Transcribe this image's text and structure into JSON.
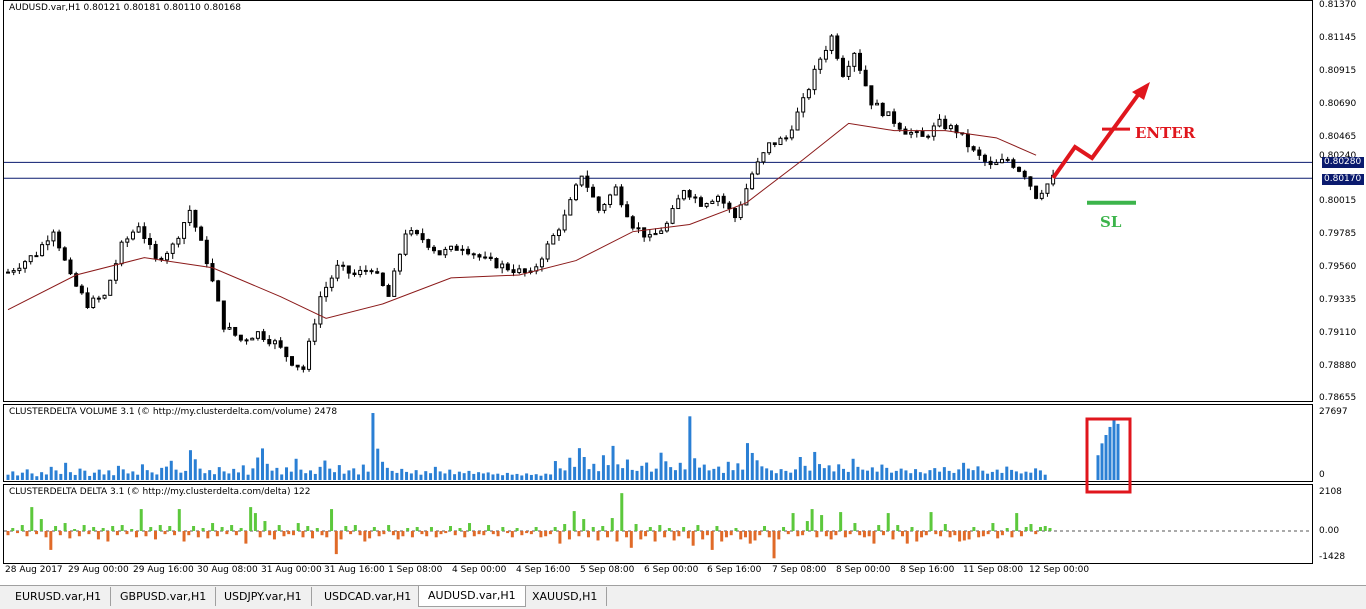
{
  "main_title": "AUDUSD.var,H1  0.80121 0.80181 0.80110 0.80168",
  "volume_title": "CLUSTERDELTA VOLUME 3.1 (© http://my.clusterdelta.com/volume) 2478",
  "delta_title": "CLUSTERDELTA DELTA 3.1 (© http://my.clusterdelta.com/delta) 122",
  "price_axis": [
    "0.81370",
    "0.81145",
    "0.80915",
    "0.80690",
    "0.80465",
    "0.80240",
    "0.80015",
    "0.79785",
    "0.79560",
    "0.79335",
    "0.79110",
    "0.78880",
    "0.78655"
  ],
  "price_tags": [
    "0.80280",
    "0.80170"
  ],
  "volume_axis": [
    "27697",
    "0"
  ],
  "delta_axis": [
    "2108",
    "0.00",
    "-1428"
  ],
  "time_axis": [
    "28 Aug 2017",
    "29 Aug 00:00",
    "29 Aug 16:00",
    "30 Aug 08:00",
    "31 Aug 00:00",
    "31 Aug 16:00",
    "1 Sep 08:00",
    "4 Sep 00:00",
    "4 Sep 16:00",
    "5 Sep 08:00",
    "6 Sep 00:00",
    "6 Sep 16:00",
    "7 Sep 08:00",
    "8 Sep 00:00",
    "8 Sep 16:00",
    "11 Sep 08:00",
    "12 Sep 00:00"
  ],
  "annotations": {
    "enter": "ENTER",
    "sl": "SL"
  },
  "tabs": [
    "EURUSD.var,H1",
    "GBPUSD.var,H1",
    "USDJPY.var,H1",
    "USDCAD.var,H1",
    "AUDUSD.var,H1",
    "XAUUSD,H1"
  ],
  "active_tab": 4,
  "colors": {
    "candle": "#000000",
    "ma": "#8b1a1a",
    "hline": "#0a1a6e",
    "vol": "#2a7fd4",
    "delta_pos": "#5cc83c",
    "delta_neg": "#e06a28",
    "arrow": "#e0161d",
    "sl": "#3cb44b",
    "box": "#e0161d"
  },
  "chart_data": [
    {
      "type": "candlestick",
      "title": "AUDUSD.var,H1  0.80121 0.80181 0.80110 0.80168",
      "ylim": [
        0.78655,
        0.8137
      ],
      "horizontal_lines": [
        0.8028,
        0.8017
      ],
      "close_path": [
        {
          "t": 0,
          "v": 0.7952
        },
        {
          "t": 5,
          "v": 0.7965
        },
        {
          "t": 8,
          "v": 0.7982
        },
        {
          "t": 11,
          "v": 0.7948
        },
        {
          "t": 14,
          "v": 0.793
        },
        {
          "t": 17,
          "v": 0.7935
        },
        {
          "t": 20,
          "v": 0.797
        },
        {
          "t": 23,
          "v": 0.7985
        },
        {
          "t": 26,
          "v": 0.796
        },
        {
          "t": 29,
          "v": 0.797
        },
        {
          "t": 32,
          "v": 0.7995
        },
        {
          "t": 35,
          "v": 0.796
        },
        {
          "t": 38,
          "v": 0.7915
        },
        {
          "t": 41,
          "v": 0.7905
        },
        {
          "t": 44,
          "v": 0.791
        },
        {
          "t": 47,
          "v": 0.7903
        },
        {
          "t": 50,
          "v": 0.789
        },
        {
          "t": 52,
          "v": 0.7885
        },
        {
          "t": 55,
          "v": 0.7935
        },
        {
          "t": 58,
          "v": 0.7955
        },
        {
          "t": 61,
          "v": 0.795
        },
        {
          "t": 64,
          "v": 0.7955
        },
        {
          "t": 67,
          "v": 0.7935
        },
        {
          "t": 70,
          "v": 0.798
        },
        {
          "t": 73,
          "v": 0.7975
        },
        {
          "t": 76,
          "v": 0.7965
        },
        {
          "t": 80,
          "v": 0.797
        },
        {
          "t": 84,
          "v": 0.796
        },
        {
          "t": 88,
          "v": 0.7955
        },
        {
          "t": 92,
          "v": 0.795
        },
        {
          "t": 95,
          "v": 0.797
        },
        {
          "t": 98,
          "v": 0.799
        },
        {
          "t": 101,
          "v": 0.802
        },
        {
          "t": 104,
          "v": 0.7995
        },
        {
          "t": 107,
          "v": 0.801
        },
        {
          "t": 110,
          "v": 0.7985
        },
        {
          "t": 113,
          "v": 0.7975
        },
        {
          "t": 116,
          "v": 0.7985
        },
        {
          "t": 119,
          "v": 0.801
        },
        {
          "t": 122,
          "v": 0.8
        },
        {
          "t": 125,
          "v": 0.8005
        },
        {
          "t": 128,
          "v": 0.799
        },
        {
          "t": 131,
          "v": 0.802
        },
        {
          "t": 134,
          "v": 0.804
        },
        {
          "t": 137,
          "v": 0.8045
        },
        {
          "t": 140,
          "v": 0.807
        },
        {
          "t": 143,
          "v": 0.81
        },
        {
          "t": 145,
          "v": 0.8115
        },
        {
          "t": 147,
          "v": 0.809
        },
        {
          "t": 149,
          "v": 0.8105
        },
        {
          "t": 152,
          "v": 0.807
        },
        {
          "t": 155,
          "v": 0.806
        },
        {
          "t": 158,
          "v": 0.805
        },
        {
          "t": 161,
          "v": 0.8045
        },
        {
          "t": 164,
          "v": 0.8055
        },
        {
          "t": 167,
          "v": 0.805
        },
        {
          "t": 170,
          "v": 0.8035
        },
        {
          "t": 173,
          "v": 0.8025
        },
        {
          "t": 176,
          "v": 0.803
        },
        {
          "t": 179,
          "v": 0.802
        },
        {
          "t": 181,
          "v": 0.8005
        },
        {
          "t": 184,
          "v": 0.8017
        }
      ],
      "moving_average": [
        {
          "t": 0,
          "v": 0.7926
        },
        {
          "t": 12,
          "v": 0.795
        },
        {
          "t": 24,
          "v": 0.7962
        },
        {
          "t": 36,
          "v": 0.7955
        },
        {
          "t": 48,
          "v": 0.7935
        },
        {
          "t": 56,
          "v": 0.792
        },
        {
          "t": 66,
          "v": 0.793
        },
        {
          "t": 78,
          "v": 0.7948
        },
        {
          "t": 90,
          "v": 0.795
        },
        {
          "t": 100,
          "v": 0.796
        },
        {
          "t": 110,
          "v": 0.798
        },
        {
          "t": 120,
          "v": 0.7985
        },
        {
          "t": 130,
          "v": 0.8
        },
        {
          "t": 140,
          "v": 0.803
        },
        {
          "t": 148,
          "v": 0.8055
        },
        {
          "t": 156,
          "v": 0.805
        },
        {
          "t": 165,
          "v": 0.805
        },
        {
          "t": 174,
          "v": 0.8045
        },
        {
          "t": 181,
          "v": 0.8033
        }
      ],
      "annotations": [
        {
          "label": "ENTER",
          "price": 0.8051
        },
        {
          "label": "SL",
          "price": 0.8
        }
      ]
    },
    {
      "type": "bar",
      "title": "CLUSTERDELTA VOLUME 3.1 (© http://my.clusterdelta.com/volume) 2478",
      "ylim": [
        0,
        27697
      ],
      "values": [
        2100,
        3400,
        1800,
        2900,
        4200,
        2600,
        1500,
        3100,
        2200,
        5200,
        3800,
        2400,
        6800,
        3100,
        2000,
        4500,
        3700,
        1600,
        2900,
        4100,
        2200,
        3800,
        1900,
        5600,
        4200,
        2600,
        3400,
        2100,
        6200,
        3900,
        3000,
        2200,
        4800,
        5300,
        7600,
        4100,
        2900,
        3600,
        11800,
        8200,
        4500,
        2700,
        3900,
        2300,
        5100,
        3400,
        2600,
        4400,
        3000,
        5800,
        2100,
        4600,
        8900,
        12500,
        6400,
        3700,
        4800,
        2200,
        5000,
        3300,
        8400,
        4100,
        2700,
        3800,
        2400,
        5200,
        7700,
        4500,
        3100,
        5900,
        2500,
        3800,
        4600,
        2200,
        6100,
        3300,
        26500,
        12400,
        7200,
        4800,
        3600,
        2800,
        4400,
        3200,
        2600,
        3900,
        2100,
        3500,
        2700,
        5200,
        3400,
        2600,
        4100,
        2300,
        3300,
        2700,
        3600,
        2400,
        3100,
        2600,
        3000,
        2200,
        2500,
        1900,
        2800,
        2100,
        2400,
        1800,
        2600,
        2000,
        2300,
        1700,
        2500,
        2200,
        7500,
        4600,
        3800,
        8800,
        5200,
        12600,
        9100,
        4300,
        6400,
        3500,
        9800,
        5900,
        13500,
        6200,
        4700,
        8100,
        4000,
        3600,
        5600,
        6900,
        3300,
        4500,
        10800,
        7400,
        5100,
        3900,
        6800,
        4200,
        25200,
        8600,
        4900,
        6100,
        3800,
        4400,
        5300,
        2800,
        7200,
        3900,
        6600,
        4100,
        14600,
        10700,
        7800,
        5400,
        4600,
        3800,
        2700,
        4300,
        3600,
        2900,
        4200,
        9100,
        5600,
        3700,
        11100,
        6300,
        4700,
        5800,
        3400,
        6200,
        4400,
        3200,
        8400,
        5200,
        4100,
        3700,
        5000,
        3300,
        6100,
        4800,
        2900,
        3600,
        4500,
        3800,
        2700,
        4300,
        3100,
        2600,
        3900,
        4700,
        3300,
        5100,
        3600,
        2800,
        4200,
        6800,
        4500,
        3900,
        5400,
        3700,
        2500,
        3200,
        4100,
        2800,
        5300,
        4000,
        3400,
        2600,
        3300,
        2900,
        4600,
        3800,
        2100,
        9800,
        14500,
        17800,
        21000,
        24500,
        22200
      ]
    },
    {
      "type": "bar",
      "title": "CLUSTERDELTA DELTA 3.1 (© http://my.clusterdelta.com/delta) 122",
      "ylim": [
        -1428,
        2108
      ],
      "values": [
        -200,
        150,
        -100,
        300,
        -250,
        1200,
        -150,
        600,
        -300,
        -900,
        250,
        -200,
        400,
        -350,
        100,
        -250,
        300,
        -150,
        200,
        -400,
        150,
        -500,
        250,
        -200,
        300,
        -150,
        100,
        -300,
        1100,
        -250,
        200,
        -400,
        300,
        -150,
        250,
        -200,
        1100,
        -500,
        -200,
        250,
        -300,
        150,
        -350,
        400,
        -250,
        200,
        -150,
        300,
        -200,
        150,
        -600,
        1200,
        900,
        -300,
        500,
        -200,
        -400,
        300,
        -250,
        -150,
        -200,
        400,
        -300,
        250,
        -350,
        150,
        -200,
        -300,
        1100,
        -1100,
        -400,
        250,
        -150,
        300,
        -200,
        -500,
        -350,
        200,
        -250,
        -150,
        300,
        -200,
        -400,
        -250,
        150,
        -300,
        200,
        -150,
        -250,
        200,
        -300,
        -150,
        -100,
        250,
        -200,
        150,
        -300,
        400,
        -250,
        -150,
        -200,
        300,
        -150,
        -250,
        200,
        -100,
        -300,
        150,
        -200,
        -100,
        -150,
        200,
        -300,
        -250,
        -150,
        200,
        -600,
        350,
        -400,
        1000,
        -250,
        600,
        -300,
        200,
        -450,
        250,
        -300,
        650,
        -500,
        1900,
        -300,
        -800,
        350,
        -400,
        -250,
        200,
        -500,
        300,
        -300,
        150,
        -450,
        -250,
        200,
        -350,
        -700,
        300,
        -400,
        -200,
        -900,
        250,
        -500,
        -300,
        -200,
        150,
        -400,
        -300,
        -600,
        -450,
        -200,
        250,
        -300,
        -1300,
        -400,
        200,
        -150,
        900,
        -250,
        -200,
        500,
        1100,
        -300,
        800,
        -250,
        -400,
        -200,
        950,
        -300,
        -150,
        400,
        -200,
        -300,
        -250,
        -600,
        300,
        -200,
        900,
        -400,
        300,
        -250,
        -600,
        200,
        -500,
        -300,
        -200,
        950,
        -150,
        -250,
        350,
        -300,
        -200,
        -500,
        -450,
        -400,
        200,
        -300,
        -250,
        -150,
        400,
        -350,
        -200,
        150,
        -300,
        900,
        -250,
        200,
        350,
        -150,
        200,
        250,
        150
      ]
    }
  ]
}
